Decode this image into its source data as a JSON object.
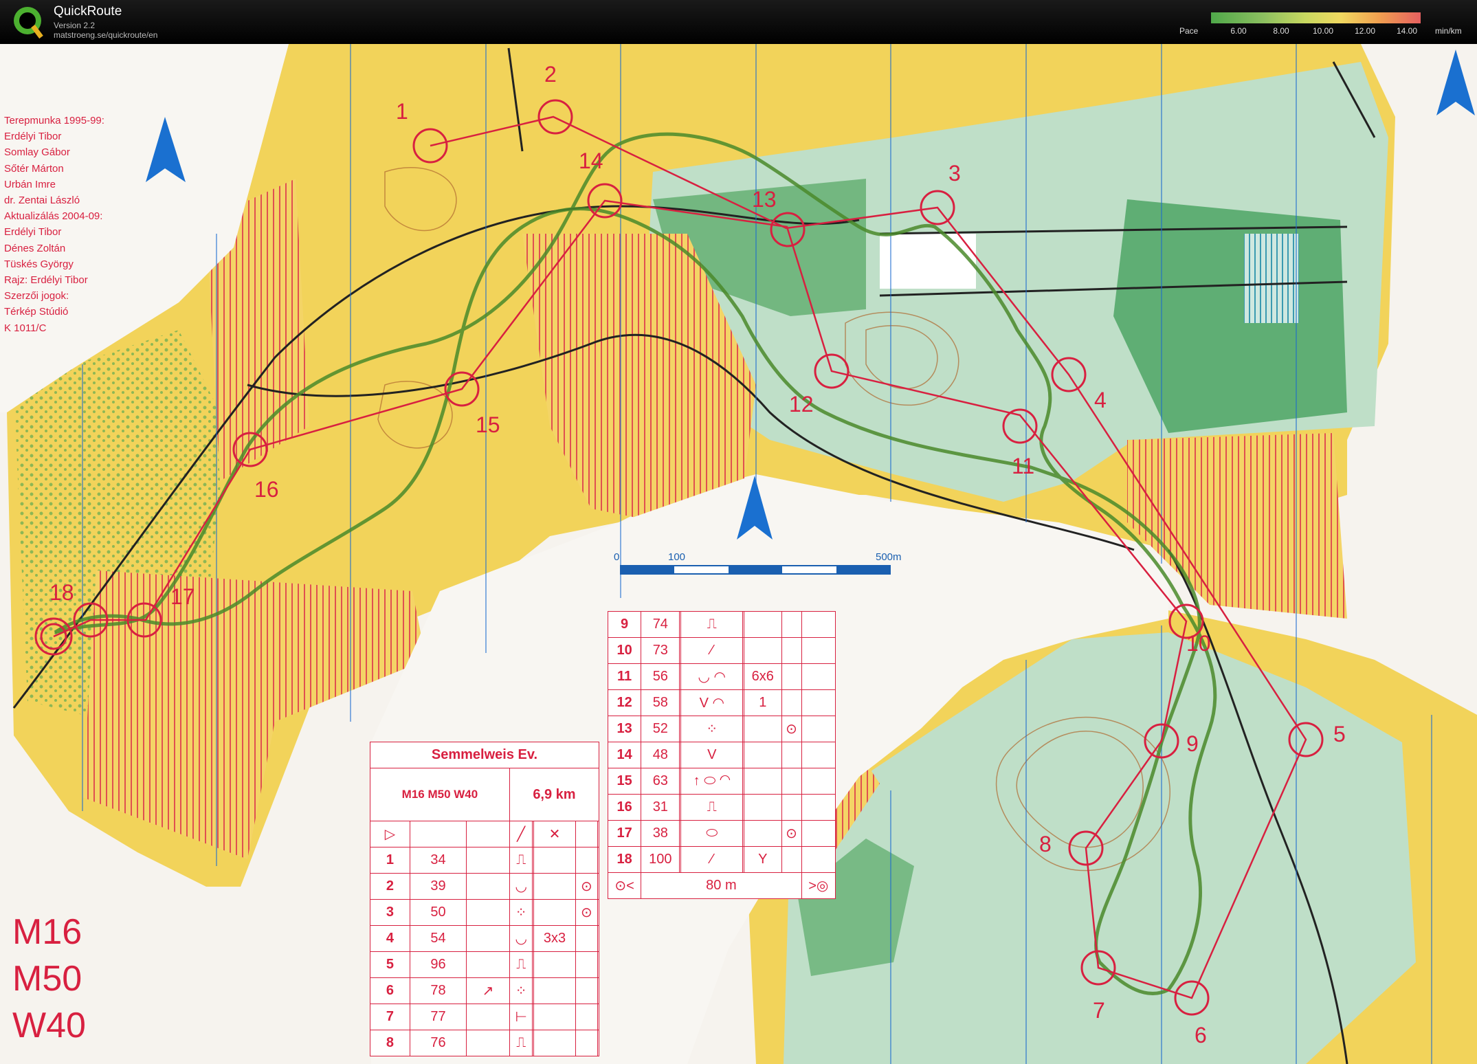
{
  "app": {
    "name": "QuickRoute",
    "version": "Version 2.2",
    "url": "matstroeng.se/quickroute/en"
  },
  "pace_legend": {
    "label": "Pace",
    "ticks": [
      "6.00",
      "8.00",
      "10.00",
      "12.00",
      "14.00"
    ],
    "unit": "min/km"
  },
  "map": {
    "credits": [
      "Terepmunka 1995-99:",
      "Erdélyi Tibor",
      "Somlay Gábor",
      "Sőtér Márton",
      "Urbán Imre",
      "dr. Zentai László",
      "Aktualizálás 2004-09:",
      "Erdélyi Tibor",
      "Dénes Zoltán",
      "Tüskés György",
      "Rajz: Erdélyi Tibor",
      "Szerzői jogok:",
      "Térkép Stúdió",
      "K 1011/C"
    ],
    "classes": [
      "M16",
      "M50",
      "W40"
    ],
    "scale": {
      "start": "0",
      "mid": "100",
      "end": "500m"
    },
    "controls": [
      "1",
      "2",
      "3",
      "4",
      "5",
      "6",
      "7",
      "8",
      "9",
      "10",
      "11",
      "12",
      "13",
      "14",
      "15",
      "16",
      "17",
      "18"
    ]
  },
  "description": {
    "event": "Semmelweis Ev.",
    "classes": "M16 M50 W40",
    "length": "6,9 km",
    "rows_a": [
      {
        "num": "1",
        "code": "34",
        "c1": "⎍",
        "c2": "",
        "c3": ""
      },
      {
        "num": "2",
        "code": "39",
        "c1": "◡",
        "c2": "",
        "c3": "⊙"
      },
      {
        "num": "3",
        "code": "50",
        "c1": "⁘",
        "c2": "",
        "c3": "⊙"
      },
      {
        "num": "4",
        "code": "54",
        "c1": "◡",
        "c2": "3x3",
        "c3": ""
      },
      {
        "num": "5",
        "code": "96",
        "c1": "⎍",
        "c2": "",
        "c3": ""
      },
      {
        "num": "6",
        "code": "78",
        "c1": "⁘",
        "c2": "",
        "c3": ""
      },
      {
        "num": "7",
        "code": "77",
        "c1": "⊢",
        "c2": "",
        "c3": ""
      },
      {
        "num": "8",
        "code": "76",
        "c1": "⎍",
        "c2": "",
        "c3": ""
      }
    ],
    "rows_b": [
      {
        "num": "9",
        "code": "74",
        "c1": "⎍",
        "c2": "",
        "c3": ""
      },
      {
        "num": "10",
        "code": "73",
        "c1": "⁄",
        "c2": "",
        "c3": ""
      },
      {
        "num": "11",
        "code": "56",
        "c1": "◡ ◠",
        "c2": "6x6",
        "c3": ""
      },
      {
        "num": "12",
        "code": "58",
        "c1": "V ◠",
        "c2": "1",
        "c3": ""
      },
      {
        "num": "13",
        "code": "52",
        "c1": "⁘",
        "c2": "",
        "c3": "⊙"
      },
      {
        "num": "14",
        "code": "48",
        "c1": "V",
        "c2": "",
        "c3": ""
      },
      {
        "num": "15",
        "code": "63",
        "c1": "↑ ⬭ ◠",
        "c2": "",
        "c3": ""
      },
      {
        "num": "16",
        "code": "31",
        "c1": "⎍",
        "c2": "",
        "c3": ""
      },
      {
        "num": "17",
        "code": "38",
        "c1": "⬭",
        "c2": "",
        "c3": "⊙"
      },
      {
        "num": "18",
        "code": "100",
        "c1": "⁄",
        "c2": "Y",
        "c3": ""
      }
    ],
    "finish": "80 m"
  },
  "colors": {
    "route": "#d82040",
    "track": "#4a8a2a",
    "north": "#1a70d0"
  }
}
